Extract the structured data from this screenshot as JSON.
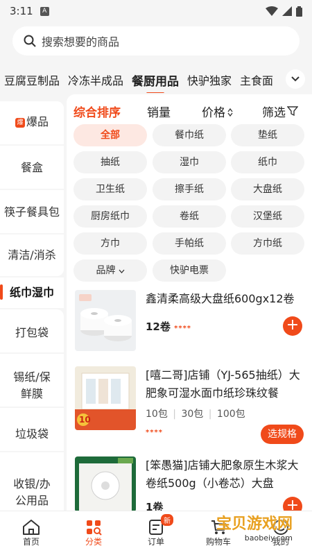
{
  "status_bar": {
    "time": "3:11",
    "app_badge": "A"
  },
  "search": {
    "placeholder": "搜索想要的商品"
  },
  "categories": {
    "tabs": [
      "豆腐豆制品",
      "冷冻半成品",
      "餐厨用品",
      "快驴独家",
      "主食面"
    ],
    "active": "餐厨用品"
  },
  "sidebar": {
    "hot_badge": "爆",
    "items": [
      "爆品",
      "餐盒",
      "筷子餐具包",
      "清洁/消杀",
      "纸巾湿巾",
      "打包袋",
      "锡纸/保鲜膜",
      "垃圾袋",
      "收银/办公用品"
    ],
    "active": "纸巾湿巾"
  },
  "sort": {
    "comprehensive": "综合排序",
    "sales": "销量",
    "price": "价格",
    "filter": "筛选"
  },
  "chips": [
    "全部",
    "餐巾纸",
    "垫纸",
    "抽纸",
    "湿巾",
    "纸巾",
    "卫生纸",
    "擦手纸",
    "大盘纸",
    "厨房纸巾",
    "卷纸",
    "汉堡纸",
    "方巾",
    "手帕纸",
    "方巾纸",
    "品牌",
    "快驴电票"
  ],
  "products": [
    {
      "title": "鑫清柔高级大盘纸600gx12卷",
      "spec": "12卷",
      "stars": "****"
    },
    {
      "title": "[嘻二哥]店铺（YJ-565抽纸）大肥象可湿水面巾纸珍珠纹餐",
      "spec_options": [
        "10包",
        "30包",
        "100包"
      ],
      "stars": "****",
      "button": "选规格"
    },
    {
      "title": "[笨愚猫]店铺大肥象原生木浆大卷纸500g（小卷芯）大盘",
      "spec": "1卷"
    }
  ],
  "thumb_text": {
    "p2_price": "10"
  },
  "bottom_nav": {
    "items": [
      "首页",
      "分类",
      "订单",
      "购物车",
      "我的"
    ],
    "active": "分类",
    "order_badge": "新"
  },
  "watermark": {
    "title": "宝贝游戏网",
    "url": "baobeiy.com"
  },
  "colors": {
    "accent": "#f04a1a",
    "chip_bg": "#f3f3f3"
  }
}
